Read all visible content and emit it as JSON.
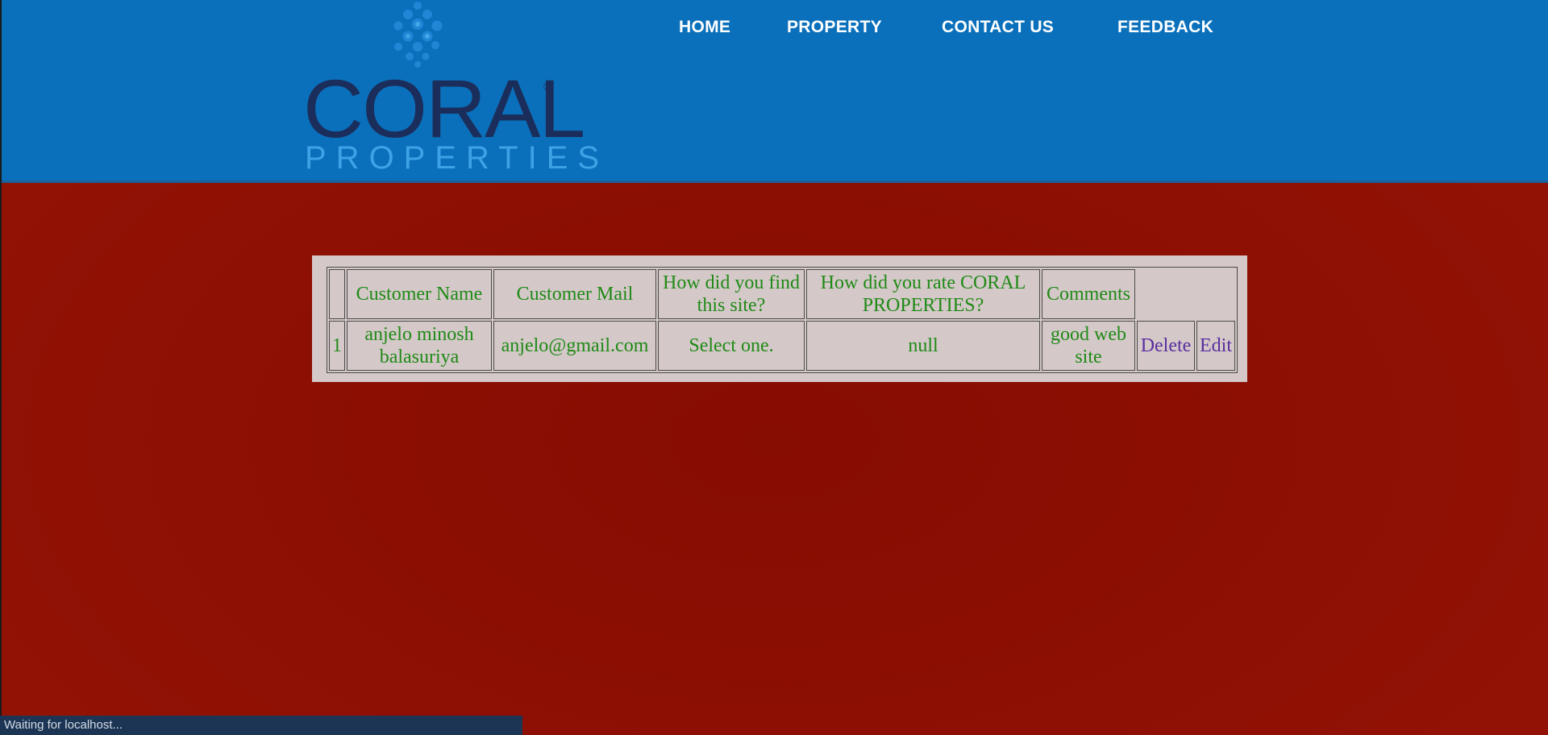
{
  "brand": {
    "logo_word": "CORAL",
    "logo_sub": "PROPERTIES",
    "logo_reg": "®",
    "brand_color": "#1b2d5a",
    "accent_color": "#3ea2e6"
  },
  "nav": {
    "items": [
      {
        "label": "HOME"
      },
      {
        "label": "PROPERTY"
      },
      {
        "label": "CONTACT US"
      },
      {
        "label": "FEEDBACK"
      }
    ]
  },
  "table": {
    "headers": {
      "index": "",
      "customer_name": "Customer Name",
      "customer_mail": "Customer Mail",
      "find_site": "How did you find this site?",
      "rate": "How did you rate CORAL PROPERTIES?",
      "comments": "Comments"
    },
    "rows": [
      {
        "index": "1",
        "customer_name": "anjelo minosh balasuriya",
        "customer_mail": "anjelo@gmail.com",
        "find_site": "Select one.",
        "rate": "null",
        "comments": "good web site",
        "delete_label": "Delete",
        "edit_label": "Edit"
      }
    ]
  },
  "statusbar": {
    "text": "Waiting for localhost..."
  },
  "colors": {
    "header_bg": "#0a70bb",
    "page_bg": "#8e0f04",
    "panel_bg": "#d4c8c8",
    "text_green": "#1f8a16",
    "link_purple": "#5a2ea0"
  }
}
